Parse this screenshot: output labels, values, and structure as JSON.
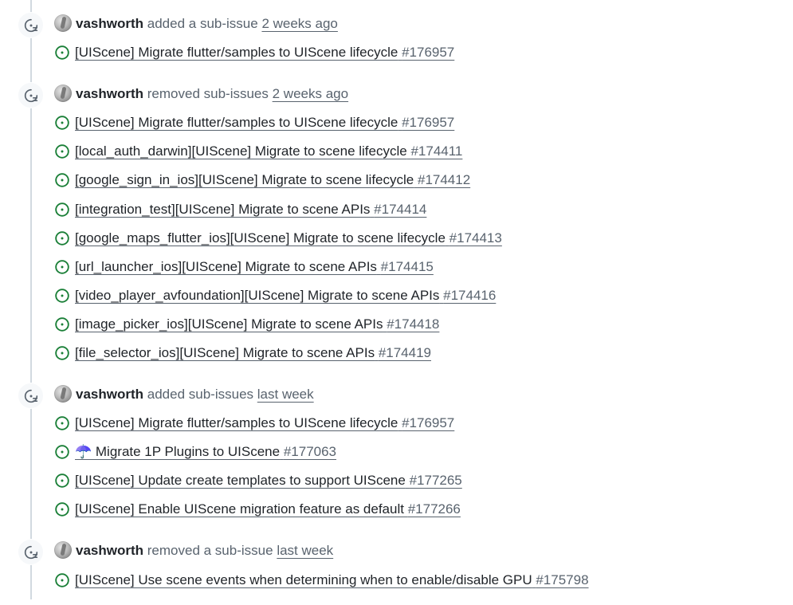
{
  "colors": {
    "open_issue_green": "#1a7f37",
    "muted_text": "#59636e",
    "primary_text": "#1f2328",
    "timeline_line": "#d1d9e0"
  },
  "events": [
    {
      "icon": "sub-issue-icon",
      "author": "vashworth",
      "action": "added a sub-issue",
      "time": "2 weeks ago",
      "issues": [
        {
          "title": "[UIScene] Migrate flutter/samples to UIScene lifecycle",
          "number": "#176957"
        }
      ]
    },
    {
      "icon": "sub-issue-icon",
      "author": "vashworth",
      "action": "removed sub-issues",
      "time": "2 weeks ago",
      "issues": [
        {
          "title": "[UIScene] Migrate flutter/samples to UIScene lifecycle",
          "number": "#176957"
        },
        {
          "title": "[local_auth_darwin][UIScene] Migrate to scene lifecycle",
          "number": "#174411"
        },
        {
          "title": "[google_sign_in_ios][UIScene] Migrate to scene lifecycle",
          "number": "#174412"
        },
        {
          "title": "[integration_test][UIScene] Migrate to scene APIs",
          "number": "#174414"
        },
        {
          "title": "[google_maps_flutter_ios][UIScene] Migrate to scene lifecycle",
          "number": "#174413"
        },
        {
          "title": "[url_launcher_ios][UIScene] Migrate to scene APIs",
          "number": "#174415"
        },
        {
          "title": "[video_player_avfoundation][UIScene] Migrate to scene APIs",
          "number": "#174416"
        },
        {
          "title": "[image_picker_ios][UIScene] Migrate to scene APIs",
          "number": "#174418"
        },
        {
          "title": "[file_selector_ios][UIScene] Migrate to scene APIs",
          "number": "#174419"
        }
      ]
    },
    {
      "icon": "sub-issue-icon",
      "author": "vashworth",
      "action": "added sub-issues",
      "time": "last week",
      "issues": [
        {
          "title": "[UIScene] Migrate flutter/samples to UIScene lifecycle",
          "number": "#176957"
        },
        {
          "title": "☂️ Migrate 1P Plugins to UIScene",
          "number": "#177063"
        },
        {
          "title": "[UIScene] Update create templates to support UIScene",
          "number": "#177265"
        },
        {
          "title": "[UIScene] Enable UIScene migration feature as default",
          "number": "#177266"
        }
      ]
    },
    {
      "icon": "sub-issue-icon",
      "author": "vashworth",
      "action": "removed a sub-issue",
      "time": "last week",
      "issues": [
        {
          "title": "[UIScene] Use scene events when determining when to enable/disable GPU",
          "number": "#175798"
        }
      ]
    }
  ]
}
